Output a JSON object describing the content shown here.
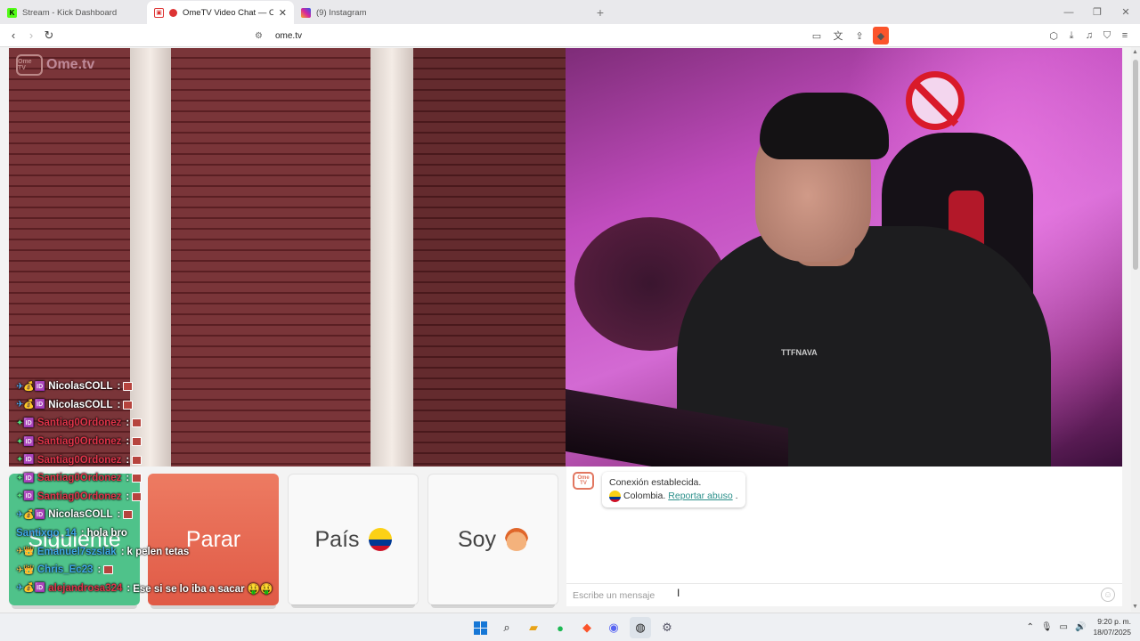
{
  "browser": {
    "tabs": [
      {
        "title": "Stream - Kick Dashboard",
        "active": false,
        "favicon": "kick-icon"
      },
      {
        "title": "OmeTV Video Chat — Omeg",
        "active": true,
        "favicon": "ometv-icon"
      },
      {
        "title": "(9) Instagram",
        "active": false,
        "favicon": "instagram-icon"
      }
    ],
    "new_tab_label": "+",
    "url": "ome.tv"
  },
  "video": {
    "logo_text": "Ome.tv",
    "logo_mark": "Ome TV",
    "shirt_text": "TTFNAVA"
  },
  "chat_overlay": [
    {
      "badges": "✈💰🆔",
      "badge_class": "",
      "user": "NicolasCOLL",
      "user_color": "#ffffff",
      "message": "",
      "emote": true
    },
    {
      "badges": "✈💰🆔",
      "badge_class": "",
      "user": "NicolasCOLL",
      "user_color": "#ffffff",
      "message": "",
      "emote": true
    },
    {
      "badges": "✦🆔",
      "badge_class": "green",
      "user": "Santiag0Ordonez",
      "user_color": "#e0344a",
      "message": "",
      "emote": true
    },
    {
      "badges": "✦🆔",
      "badge_class": "green",
      "user": "Santiag0Ordonez",
      "user_color": "#e0344a",
      "message": "",
      "emote": true
    },
    {
      "badges": "✦🆔",
      "badge_class": "green",
      "user": "Santiag0Ordonez",
      "user_color": "#e0344a",
      "message": "",
      "emote": true
    },
    {
      "badges": "✦🆔",
      "badge_class": "green",
      "user": "Santiag0Ordonez",
      "user_color": "#e0344a",
      "message": "",
      "emote": true
    },
    {
      "badges": "✦🆔",
      "badge_class": "green",
      "user": "Santiag0Ordonez",
      "user_color": "#e0344a",
      "message": "",
      "emote": true
    },
    {
      "badges": "✈💰🆔",
      "badge_class": "",
      "user": "NicolasCOLL",
      "user_color": "#ffffff",
      "message": "",
      "emote": true
    },
    {
      "badges": "",
      "badge_class": "",
      "user": "Santixgo_14",
      "user_color": "#3fa8e8",
      "message": "hola bro",
      "emote": false
    },
    {
      "badges": "✈👑",
      "badge_class": "gold",
      "user": "Emanuel7szslak",
      "user_color": "#3fa8e8",
      "message": "k pelen tetas",
      "emote": false
    },
    {
      "badges": "✈👑",
      "badge_class": "gold",
      "user": "Chris_Ec23",
      "user_color": "#3fa8e8",
      "message": "",
      "emote": true
    },
    {
      "badges": "✈💰🆔",
      "badge_class": "",
      "user": "alejandrosa324",
      "user_color": "#e0344a",
      "message": "Ese si se lo iba a sacar 🤑🤑",
      "emote": false
    }
  ],
  "controls": {
    "next_label": "Siguiente",
    "stop_label": "Parar",
    "country_label": "País",
    "gender_label": "Soy"
  },
  "chat": {
    "avatar_text": "Ome TV",
    "system_line1": "Conexión establecida.",
    "system_country": "Colombia.",
    "report_link": "Reportar abuso",
    "report_suffix": ".",
    "input_placeholder": "Escribe un mensaje"
  },
  "taskbar": {
    "time": "9:20 p. m.",
    "date": "18/07/2025"
  },
  "colors": {
    "next_button": "#4fc28a",
    "stop_button": "#e96b55",
    "link": "#2a8f8a",
    "brave": "#fb542b"
  }
}
